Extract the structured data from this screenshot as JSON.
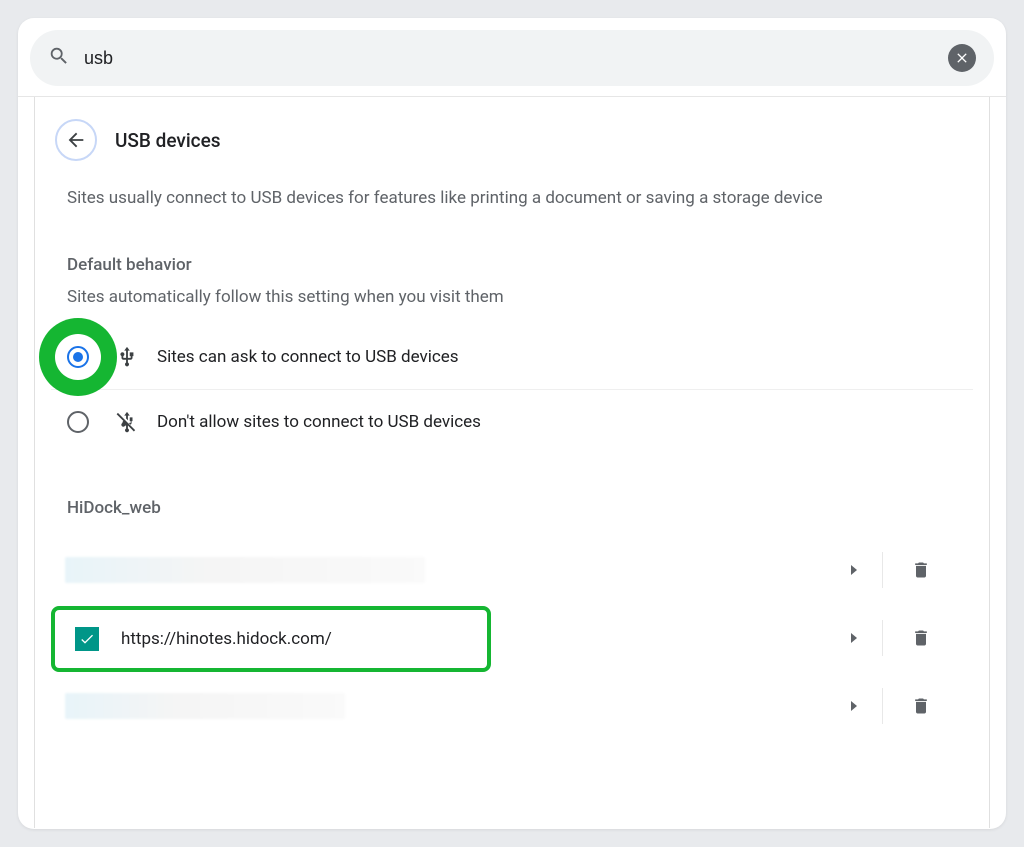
{
  "search": {
    "value": "usb"
  },
  "page": {
    "title": "USB devices",
    "description": "Sites usually connect to USB devices for features like printing a document or saving a storage device"
  },
  "default_behavior": {
    "label": "Default behavior",
    "sub": "Sites automatically follow this setting when you visit them",
    "options": [
      {
        "label": "Sites can ask to connect to USB devices",
        "checked": true,
        "icon": "usb"
      },
      {
        "label": "Don't allow sites to connect to USB devices",
        "checked": false,
        "icon": "usb-off"
      }
    ]
  },
  "device_section": {
    "label": "HiDock_web",
    "items": [
      {
        "url": "",
        "hidden": true
      },
      {
        "url": "https://hinotes.hidock.com/",
        "hidden": false,
        "highlighted": true
      },
      {
        "url": "",
        "hidden": true
      }
    ]
  }
}
